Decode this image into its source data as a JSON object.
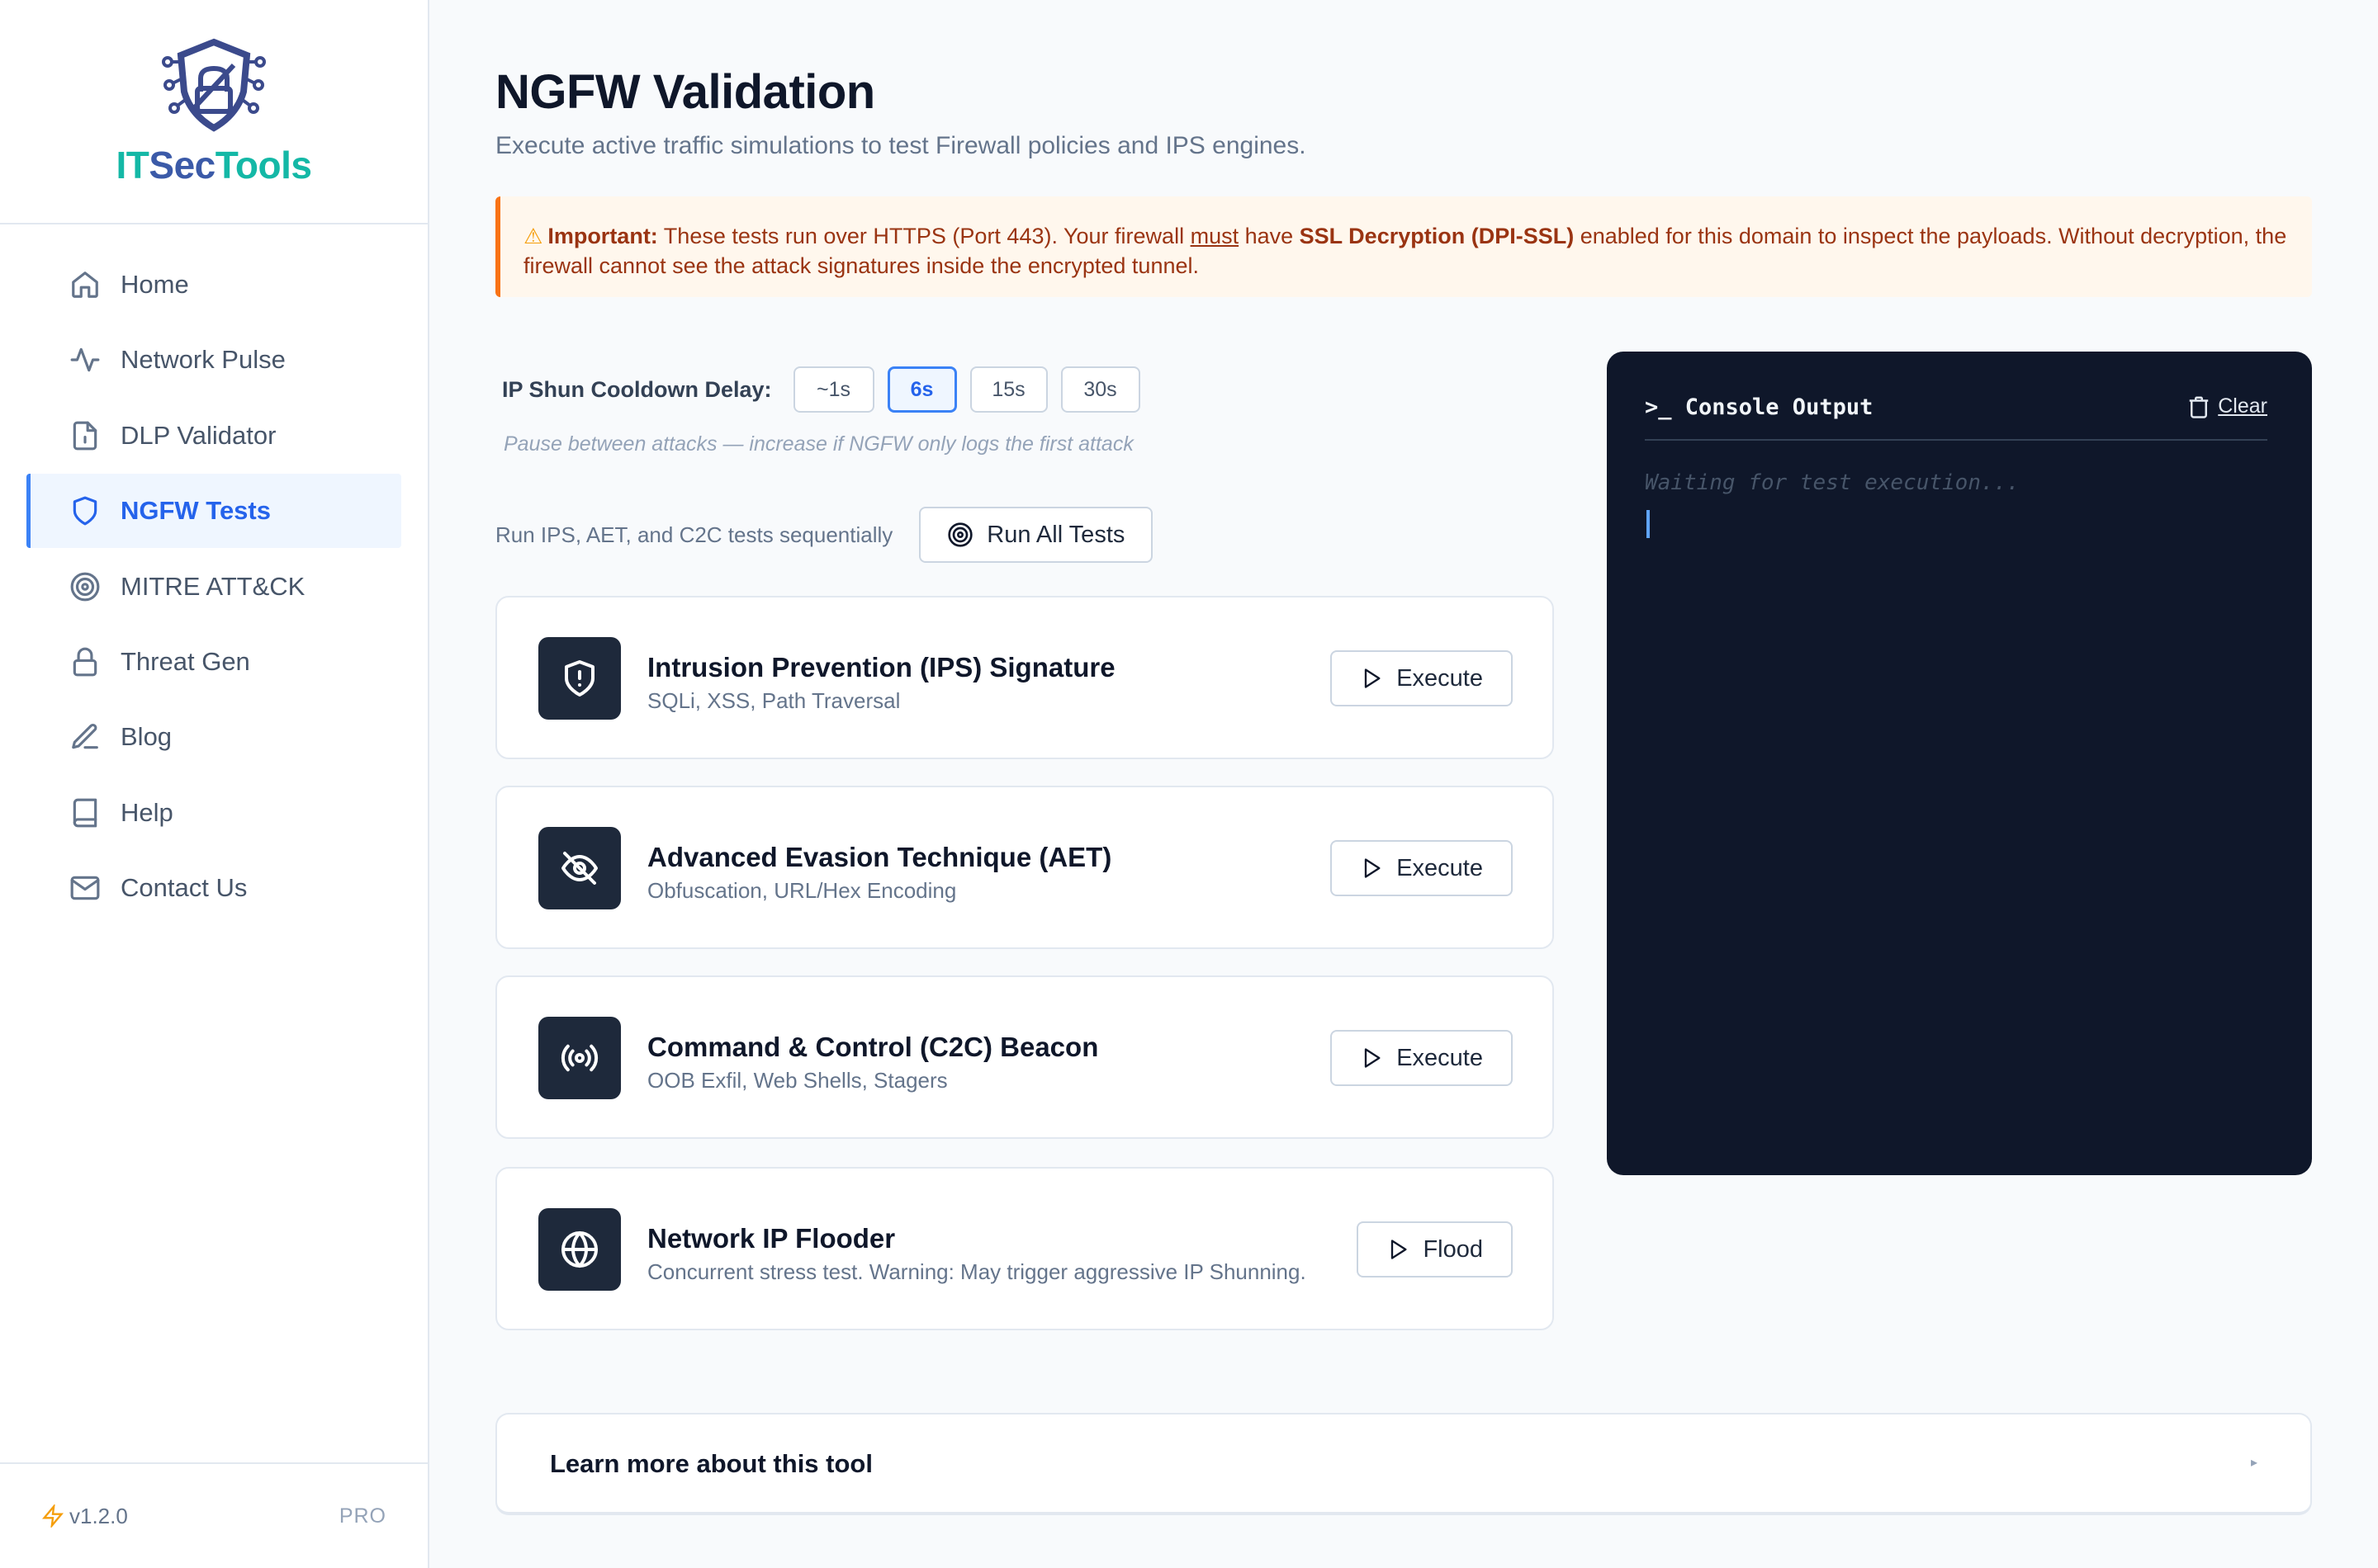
{
  "brand": {
    "part1": "IT",
    "part2": "Sec",
    "part3": "Tools"
  },
  "nav": {
    "items": [
      {
        "label": "Home",
        "icon": "home-icon"
      },
      {
        "label": "Network Pulse",
        "icon": "activity-icon"
      },
      {
        "label": "DLP Validator",
        "icon": "file-icon"
      },
      {
        "label": "NGFW Tests",
        "icon": "shield-icon",
        "active": true
      },
      {
        "label": "MITRE ATT&CK",
        "icon": "target-icon"
      },
      {
        "label": "Threat Gen",
        "icon": "lock-icon"
      },
      {
        "label": "Blog",
        "icon": "pen-icon"
      },
      {
        "label": "Help",
        "icon": "book-icon"
      },
      {
        "label": "Contact Us",
        "icon": "mail-icon"
      }
    ]
  },
  "footer": {
    "version": "v1.2.0",
    "tier": "PRO"
  },
  "page": {
    "title": "NGFW Validation",
    "subtitle": "Execute active traffic simulations to test Firewall policies and IPS engines."
  },
  "alert": {
    "icon": "⚠",
    "label": "Important:",
    "text1": " These tests run over HTTPS (Port 443). Your firewall ",
    "must": "must",
    "text2": " have ",
    "strong": "SSL Decryption (DPI-SSL)",
    "text3": " enabled for this domain to inspect the payloads. Without decryption, the firewall cannot see the attack signatures inside the encrypted tunnel."
  },
  "cooldown": {
    "label": "IP Shun Cooldown Delay:",
    "options": [
      "~1s",
      "6s",
      "15s",
      "30s"
    ],
    "selected": "6s",
    "hint": "Pause between attacks — increase if NGFW only logs the first attack"
  },
  "run_all": {
    "text": "Run IPS, AET, and C2C tests sequentially",
    "button": "Run All Tests"
  },
  "tests": [
    {
      "title": "Intrusion Prevention (IPS) Signature",
      "desc": "SQLi, XSS, Path Traversal",
      "action": "Execute",
      "icon": "shield-alert-icon"
    },
    {
      "title": "Advanced Evasion Technique (AET)",
      "desc": "Obfuscation, URL/Hex Encoding",
      "action": "Execute",
      "icon": "eye-off-icon"
    },
    {
      "title": "Command & Control (C2C) Beacon",
      "desc": "OOB Exfil, Web Shells, Stagers",
      "action": "Execute",
      "icon": "radio-icon"
    },
    {
      "title": "Network IP Flooder",
      "desc": "Concurrent stress test. Warning: May trigger aggressive IP Shunning.",
      "action": "Flood",
      "icon": "globe-icon"
    }
  ],
  "console": {
    "title": ">_ Console Output",
    "clear": "Clear",
    "placeholder": "Waiting for test execution..."
  },
  "learn_more": {
    "title": "Learn more about this tool",
    "arrow": "▸"
  }
}
